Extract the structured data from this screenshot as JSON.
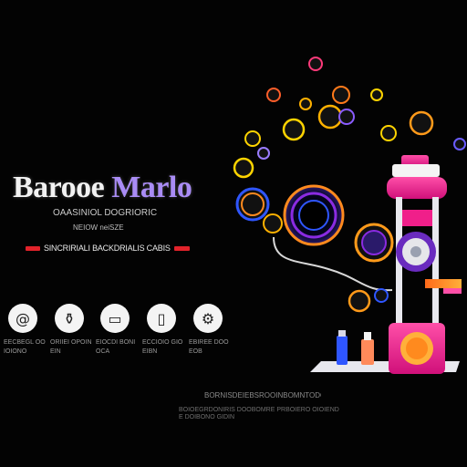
{
  "brand": {
    "word_1": "Barooe",
    "word_2": "Marlo",
    "line_a": "OAASINIOL DOGRIORIC",
    "line_b": "NEIOW neiSZE",
    "tagline": "SINCRIRIALI BACKDRIALIS CABIS"
  },
  "features": [
    {
      "icon": "at-sign-icon",
      "glyph": "@",
      "caption": "EECBEGL OOIOIONO"
    },
    {
      "icon": "bottle-icon",
      "glyph": "⚱",
      "caption": "ORIIEI OPOINEIN"
    },
    {
      "icon": "device-icon",
      "glyph": "▭",
      "caption": "EIOCDI BONIOCA"
    },
    {
      "icon": "tube-icon",
      "glyph": "▯",
      "caption": "ECCIOIO GIOEIBN"
    },
    {
      "icon": "machine-icon",
      "glyph": "⚙",
      "caption": "EBIREE DOOEOB"
    }
  ],
  "footer": {
    "line_1": "BORNISDEIEBSROOINBOMNTODOBE",
    "line_2": "BOIOEGRDONIRIS DOOBOMRE PRBOIERO OIOIENDE DOIBONO GIDIN"
  },
  "colors": {
    "background": "#030303",
    "title_accent": "#a98cf5",
    "tagline_red": "#e2222a",
    "machine_pink": "#f01f8a",
    "machine_orange": "#ff8a1e",
    "bubble_blue": "#2f56ff",
    "bubble_purple": "#8a2be2"
  }
}
